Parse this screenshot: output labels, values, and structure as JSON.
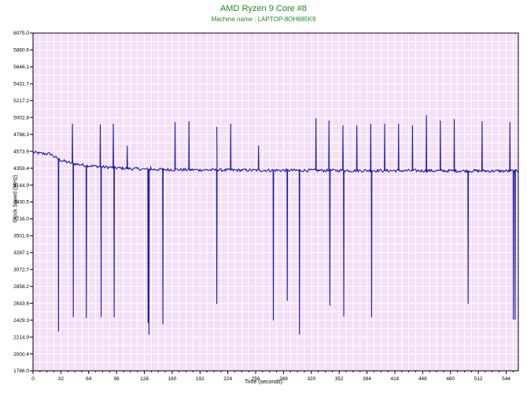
{
  "chart_data": {
    "type": "line",
    "title": "AMD Ryzen 9 Core #8",
    "subtitle": "Machine name : LAPTOP-8OH685K9",
    "xlabel": "Time (seconds)",
    "ylabel": "Clock Speed (MHz)",
    "xlim": [
      0,
      558
    ],
    "ylim": [
      1786.0,
      6075.0
    ],
    "x_ticks": [
      "0",
      "32",
      "64",
      "96",
      "128",
      "160",
      "192",
      "224",
      "256",
      "288",
      "320",
      "352",
      "384",
      "416",
      "448",
      "480",
      "512",
      "544"
    ],
    "y_ticks": [
      "1786.0",
      "2000.4",
      "2214.9",
      "2429.3",
      "2643.8",
      "2858.2",
      "3072.7",
      "3287.1",
      "3501.6",
      "3716.0",
      "3930.5",
      "4144.9",
      "4359.4",
      "4573.9",
      "4788.3",
      "5002.8",
      "5217.2",
      "5431.7",
      "5646.1",
      "5860.6",
      "6075.0"
    ],
    "grid": true,
    "colors": {
      "plot_bg": "#f3dff8",
      "grid": "#ffffff",
      "line": "#1a1aa8",
      "title": "#1f8a1f",
      "axis": "#000000"
    },
    "baseline": [
      [
        0,
        4560
      ],
      [
        10,
        4545
      ],
      [
        20,
        4540
      ],
      [
        25,
        4500
      ],
      [
        32,
        4460
      ],
      [
        45,
        4420
      ],
      [
        60,
        4395
      ],
      [
        80,
        4375
      ],
      [
        100,
        4360
      ],
      [
        130,
        4345
      ],
      [
        170,
        4340
      ],
      [
        220,
        4335
      ],
      [
        280,
        4332
      ],
      [
        350,
        4330
      ],
      [
        420,
        4328
      ],
      [
        500,
        4325
      ],
      [
        558,
        4322
      ]
    ],
    "spikes": [
      {
        "x": 29,
        "value": 2290
      },
      {
        "x": 45,
        "value": 4920
      },
      {
        "x": 46,
        "value": 2470
      },
      {
        "x": 61,
        "value": 2460
      },
      {
        "x": 77,
        "value": 4910
      },
      {
        "x": 78,
        "value": 2470
      },
      {
        "x": 92,
        "value": 4920
      },
      {
        "x": 93,
        "value": 2470
      },
      {
        "x": 108,
        "value": 4640
      },
      {
        "x": 132,
        "value": 2400
      },
      {
        "x": 133,
        "value": 2250
      },
      {
        "x": 135,
        "value": 4380
      },
      {
        "x": 149,
        "value": 2380
      },
      {
        "x": 163,
        "value": 4940
      },
      {
        "x": 179,
        "value": 4950
      },
      {
        "x": 211,
        "value": 2640
      },
      {
        "x": 211,
        "value": 4880
      },
      {
        "x": 227,
        "value": 4920
      },
      {
        "x": 259,
        "value": 4640
      },
      {
        "x": 276,
        "value": 2430
      },
      {
        "x": 292,
        "value": 2680
      },
      {
        "x": 306,
        "value": 2250
      },
      {
        "x": 325,
        "value": 4990
      },
      {
        "x": 340,
        "value": 4960
      },
      {
        "x": 341,
        "value": 2620
      },
      {
        "x": 356,
        "value": 4900
      },
      {
        "x": 357,
        "value": 2480
      },
      {
        "x": 372,
        "value": 4900
      },
      {
        "x": 388,
        "value": 4920
      },
      {
        "x": 389,
        "value": 2470
      },
      {
        "x": 404,
        "value": 4920
      },
      {
        "x": 420,
        "value": 4920
      },
      {
        "x": 436,
        "value": 4900
      },
      {
        "x": 452,
        "value": 5030
      },
      {
        "x": 468,
        "value": 4960
      },
      {
        "x": 484,
        "value": 4980
      },
      {
        "x": 500,
        "value": 2640
      },
      {
        "x": 516,
        "value": 4950
      },
      {
        "x": 548,
        "value": 4940
      },
      {
        "x": 552,
        "value": 2440
      },
      {
        "x": 554,
        "value": 2440
      }
    ]
  }
}
